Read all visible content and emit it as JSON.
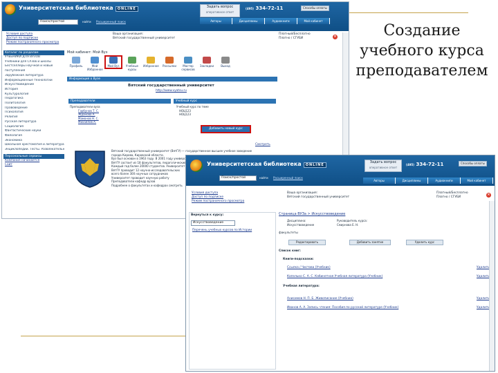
{
  "slide": {
    "title_line1": "Создание",
    "title_line2": "учебного курса",
    "title_line3": "преподавателем"
  },
  "colors": {
    "header_blue": "#1560a0",
    "accent_red": "#cc1111",
    "tab_blue": "#2f86c9"
  },
  "back": {
    "brand": "Университетская библиотека",
    "online": "ONLINE",
    "ask_title": "Задать вопрос",
    "ask_sub": "оперативное ответ",
    "phone_prefix": "(495)",
    "phone": "334-72-11",
    "pay_button": "Способы оплаты",
    "search_value": "Поиск/простой",
    "search_go": "найти",
    "advanced_search": "Расширенный поиск",
    "tabs": [
      "Авторы",
      "Дисциплины",
      "Аудиокниги",
      "Мой кабинет"
    ],
    "user_links": [
      "Условия доступа",
      "Доступ по подписке",
      "Режим постраничного просмотра"
    ],
    "org_label": "Ваша организация:",
    "org_value": "Вятский государственный университет",
    "sub_label": "Платный/Бесплатно",
    "sub_value": "Платно / СГУБИ",
    "sidebar_head": "Каталог по разделам",
    "sidebar_items": [
      "УЧЕБНИКИ ДЛЯ ВУЗОВ",
      "Учебники для СУЗов и школы",
      "Бестселлеры научной и новые",
      "поступления",
      "Зарубежная литература",
      "Информационные технологии",
      "Искусствоведение",
      "История",
      "Культурология",
      "Педагогика",
      "Политология",
      "Правоведение",
      "Психология",
      "Религия",
      "Русская литература",
      "Социология",
      "Фантастические науки",
      "Филология",
      "Экономика",
      "Школьная хрестоматия и литература",
      "Энциклопедии. Тесты. Развлекательные игры"
    ],
    "sidebar_extra_head": "Персональные сервисы",
    "sidebar_extra": [
      "Компания начинается",
      "Сайт"
    ],
    "crumb": "Мой кабинет: Мой Вуз",
    "icons": [
      "Профиль",
      "Мой Избранное",
      "Мой Вуз",
      "Учебные курсы",
      "Избранное",
      "Рассылки",
      "Мастер сервисов",
      "Закладки",
      "Выход"
    ],
    "univ_section": "Информация о Вузе",
    "univ_name": "Вятский государственный университет",
    "univ_link": "http://www.vyatsu.ru",
    "teachers_head": "Преподаватели",
    "teachers_lines": [
      "Преподаватели вуза",
      "Горбунов Т. С.",
      "Жданова А.",
      "Мамонов Н. С.",
      "Михайлов А."
    ],
    "courses_head": "Учебный курс",
    "courses_lines": [
      "Учебный курс по теме",
      "НОЦ123",
      "НОЦ123"
    ],
    "add_course": "Добавить новый курс",
    "desc": [
      "Вятский государственный университет (ВятГУ) — государственное высшее учебное заведение",
      "города Кирова, Кировской области.",
      "Вуз был основан в 1963 году. В 2001 году университет",
      "ВятГУ состоит из 18 факультетов, педагогический",
      "Каждый год более 20000 студентов. Университет",
      "ВятГУ проводит 12 научно-исследовательских",
      "всего более 300 научных сотрудников",
      "Университет проводит научную работу",
      "Преподаватели кафедр вузов",
      "Подробнее о факультетах и кафедрах смотреть"
    ],
    "more_link": "Смотреть"
  },
  "front": {
    "brand": "Университетская библиотека",
    "online": "ONLINE",
    "ask_title": "Задать вопрос",
    "ask_sub": "оперативное ответ",
    "phone_prefix": "(495)",
    "phone": "334-72-11",
    "pay_button": "Способы оплаты",
    "search_value": "Поиск/простой",
    "search_go": "найти",
    "advanced_search": "Расширенный поиск",
    "tabs": [
      "Авторы",
      "Дисциплины",
      "Аудиокниги",
      "Мой кабинет"
    ],
    "user_links": [
      "Условия доступа",
      "Доступ по подписке",
      "Режим постраничного просмотра"
    ],
    "org_label": "Ваша организация:",
    "org_value": "Вятский государственный университет",
    "sub_label": "Платный/Бесплатно",
    "sub_value": "Платно / СГУБИ",
    "left_head": "Вернуться к курсу:",
    "left_select": "Искусствоведение",
    "left_link": "Перечень учебных курсов по Истории",
    "crumb": "Страница ВУЗа > Искусствоведение",
    "owner_label": "Дисциплина:",
    "owner_value": "Искусствоведение",
    "author_label": "Руководитель курса:",
    "author_value": "Смирнова Е. Н.",
    "faculty_label": "факультеты",
    "buttons": [
      "Редактировать",
      "Добавить занятие",
      "Удалить курс"
    ],
    "list_head": "Список книг:",
    "group1": "Книги-подсказки:",
    "group1_items": [
      "Ссылка / Чистова (Учебник)",
      "Капелько С. А. С. Кабинетная Учебная литература (Учебник)"
    ],
    "group2": "Учебная литература:",
    "group2_items": [
      "Анисимов Н. П. Б. Живописание (Учебник)",
      "Иванов А. А. Запись чтения: Пособия по русской литературе (Учебник)"
    ],
    "del_label": "Удалить"
  }
}
